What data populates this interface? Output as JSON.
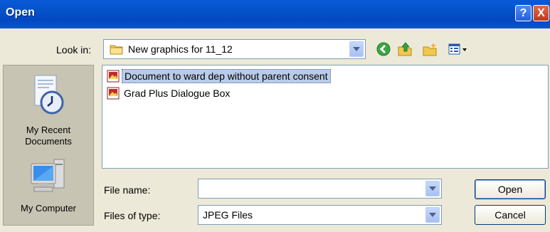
{
  "window": {
    "title": "Open",
    "help_glyph": "?",
    "close_glyph": "X"
  },
  "look_in": {
    "label": "Look in:",
    "value": "New graphics for 11_12",
    "icon": "folder-icon"
  },
  "toolbar": {
    "icons": [
      "back-icon",
      "up-folder-icon",
      "new-folder-icon",
      "views-menu-icon"
    ]
  },
  "places": [
    {
      "label": "My Recent Documents",
      "icon": "recent-documents-icon"
    },
    {
      "label": "My Computer",
      "icon": "my-computer-icon"
    }
  ],
  "files": [
    {
      "name": "Document to ward dep without parent consent",
      "icon": "jpeg-image-icon",
      "selected": true
    },
    {
      "name": "Grad Plus Dialogue Box",
      "icon": "jpeg-image-icon",
      "selected": false
    }
  ],
  "form": {
    "file_name_label": "File name:",
    "file_name_value": "",
    "files_of_type_label": "Files of type:",
    "files_of_type_value": "JPEG Files"
  },
  "buttons": {
    "open": "Open",
    "cancel": "Cancel"
  },
  "colors": {
    "titlebar": "#0453c9",
    "dialog_bg": "#ece9d8",
    "selection": "#b9cbe8",
    "close_button": "#c1391b",
    "border": "#7f9db9"
  }
}
